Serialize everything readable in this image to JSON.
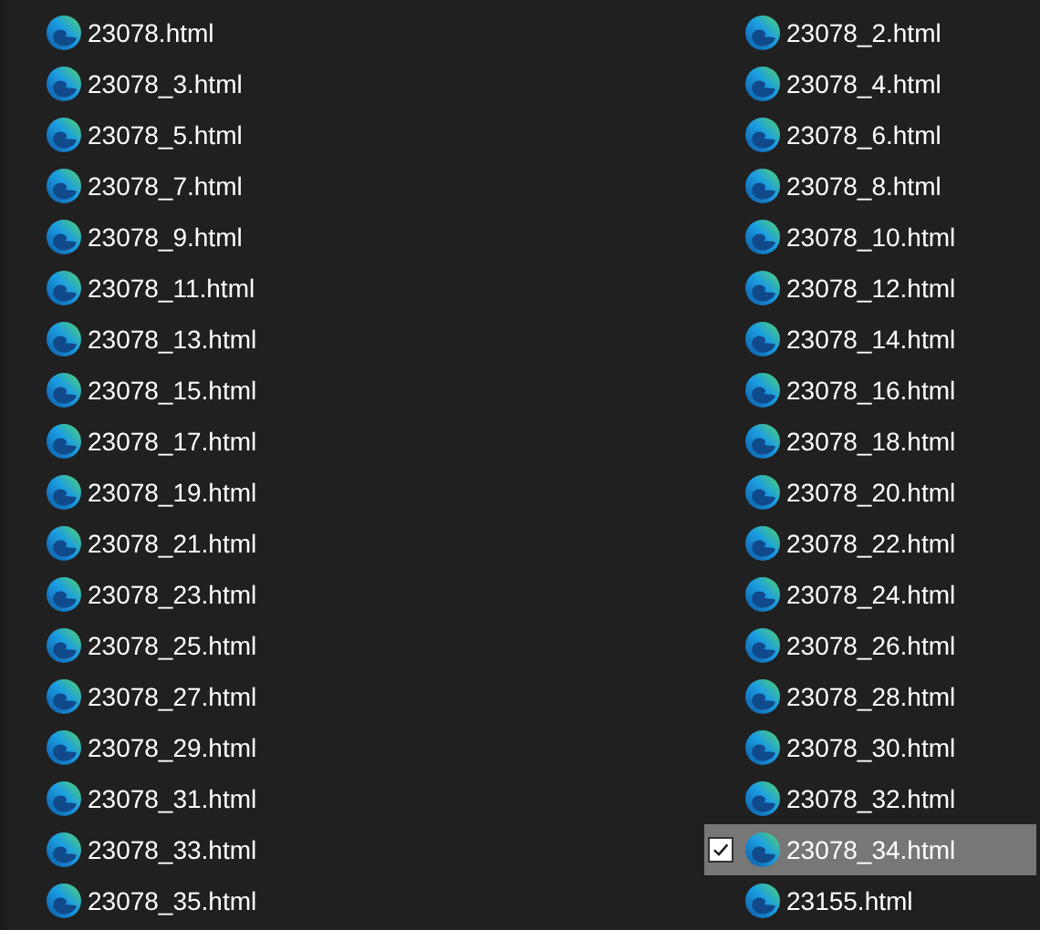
{
  "files": [
    {
      "name": "23078.html",
      "selected": false,
      "checked": false
    },
    {
      "name": "23078_2.html",
      "selected": false,
      "checked": false
    },
    {
      "name": "23078_3.html",
      "selected": false,
      "checked": false
    },
    {
      "name": "23078_4.html",
      "selected": false,
      "checked": false
    },
    {
      "name": "23078_5.html",
      "selected": false,
      "checked": false
    },
    {
      "name": "23078_6.html",
      "selected": false,
      "checked": false
    },
    {
      "name": "23078_7.html",
      "selected": false,
      "checked": false
    },
    {
      "name": "23078_8.html",
      "selected": false,
      "checked": false
    },
    {
      "name": "23078_9.html",
      "selected": false,
      "checked": false
    },
    {
      "name": "23078_10.html",
      "selected": false,
      "checked": false
    },
    {
      "name": "23078_11.html",
      "selected": false,
      "checked": false
    },
    {
      "name": "23078_12.html",
      "selected": false,
      "checked": false
    },
    {
      "name": "23078_13.html",
      "selected": false,
      "checked": false
    },
    {
      "name": "23078_14.html",
      "selected": false,
      "checked": false
    },
    {
      "name": "23078_15.html",
      "selected": false,
      "checked": false
    },
    {
      "name": "23078_16.html",
      "selected": false,
      "checked": false
    },
    {
      "name": "23078_17.html",
      "selected": false,
      "checked": false
    },
    {
      "name": "23078_18.html",
      "selected": false,
      "checked": false
    },
    {
      "name": "23078_19.html",
      "selected": false,
      "checked": false
    },
    {
      "name": "23078_20.html",
      "selected": false,
      "checked": false
    },
    {
      "name": "23078_21.html",
      "selected": false,
      "checked": false
    },
    {
      "name": "23078_22.html",
      "selected": false,
      "checked": false
    },
    {
      "name": "23078_23.html",
      "selected": false,
      "checked": false
    },
    {
      "name": "23078_24.html",
      "selected": false,
      "checked": false
    },
    {
      "name": "23078_25.html",
      "selected": false,
      "checked": false
    },
    {
      "name": "23078_26.html",
      "selected": false,
      "checked": false
    },
    {
      "name": "23078_27.html",
      "selected": false,
      "checked": false
    },
    {
      "name": "23078_28.html",
      "selected": false,
      "checked": false
    },
    {
      "name": "23078_29.html",
      "selected": false,
      "checked": false
    },
    {
      "name": "23078_30.html",
      "selected": false,
      "checked": false
    },
    {
      "name": "23078_31.html",
      "selected": false,
      "checked": false
    },
    {
      "name": "23078_32.html",
      "selected": false,
      "checked": false
    },
    {
      "name": "23078_33.html",
      "selected": false,
      "checked": false
    },
    {
      "name": "23078_34.html",
      "selected": true,
      "checked": true
    },
    {
      "name": "23078_35.html",
      "selected": false,
      "checked": false
    },
    {
      "name": "23155.html",
      "selected": false,
      "checked": false
    }
  ]
}
